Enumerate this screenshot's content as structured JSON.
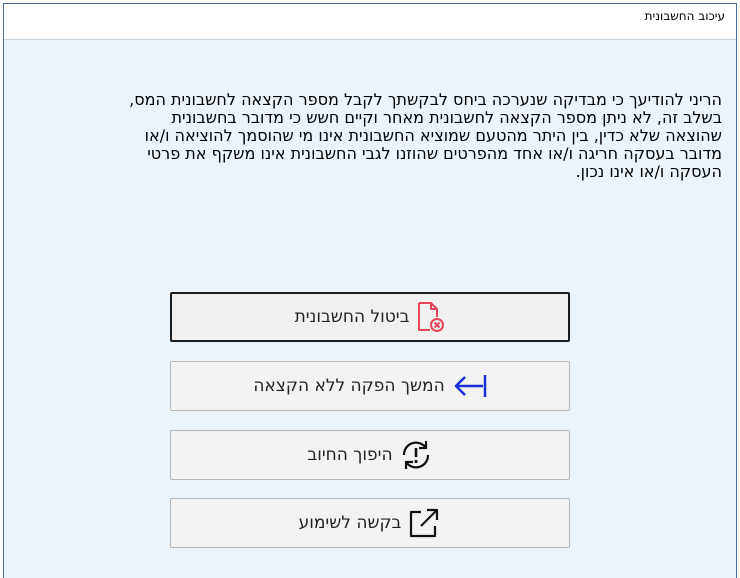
{
  "window": {
    "title": "עיכוב החשבונית"
  },
  "message": "הריני להודיעך כי מבדיקה שנערכה ביחס לבקשתך לקבל מספר הקצאה לחשבונית המס,\nבשלב זה, לא ניתן מספר הקצאה לחשבונית מאחר וקיים חשש כי מדובר בחשבונית\nשהוצאה שלא כדין, בין היתר מהטעם שמוציא החשבונית אינו מי שהוסמך להוציאה ו/או\nמדובר בעסקה חריגה ו/או אחד מהפרטים שהוזנו לגבי החשבונית אינו משקף את פרטי\nהעסקה ו/או אינו נכון.",
  "buttons": {
    "cancel_invoice": {
      "label": "ביטול החשבונית",
      "icon": "document-cancel-icon"
    },
    "continue_without_allocation": {
      "label": "המשך הפקה ללא הקצאה",
      "icon": "arrow-left-bar-icon"
    },
    "reverse_charge": {
      "label": "היפוך החיוב",
      "icon": "refresh-alert-icon"
    },
    "hearing_request": {
      "label": "בקשה לשימוע",
      "icon": "external-link-icon"
    }
  },
  "colors": {
    "accent_red": "#e8455a",
    "accent_blue": "#1a2fd6"
  }
}
